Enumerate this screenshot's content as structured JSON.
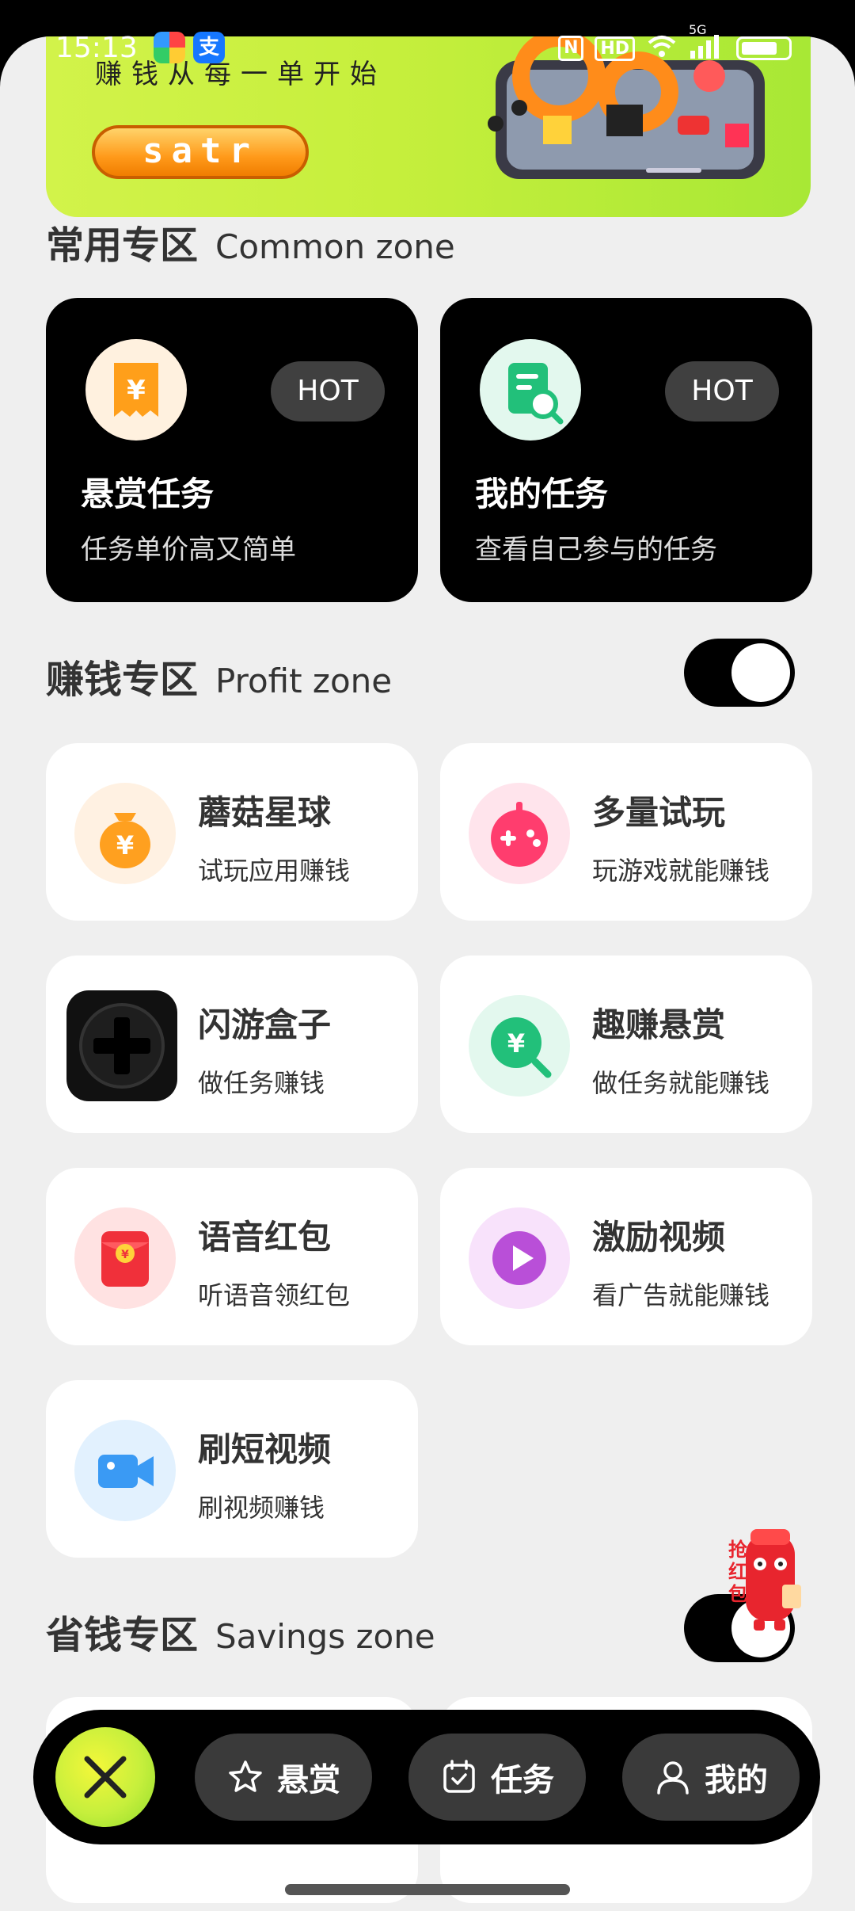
{
  "status": {
    "time": "15:13",
    "network": "5G"
  },
  "banner": {
    "slogan": "赚钱从每一单开始",
    "start_label": "satr"
  },
  "common": {
    "title": "常用专区",
    "subtitle": "Common zone",
    "cards": [
      {
        "title": "悬赏任务",
        "desc": "任务单价高又简单",
        "badge": "HOT",
        "icon": "reward-receipt-icon",
        "color": "#ff9f1a"
      },
      {
        "title": "我的任务",
        "desc": "查看自己参与的任务",
        "badge": "HOT",
        "icon": "task-search-icon",
        "color": "#22c07a"
      }
    ]
  },
  "profit": {
    "title": "赚钱专区",
    "subtitle": "Profit zone",
    "toggle_on": true,
    "items": [
      {
        "title": "蘑菇星球",
        "desc": "试玩应用赚钱",
        "icon": "money-bag-icon"
      },
      {
        "title": "多量试玩",
        "desc": "玩游戏就能赚钱",
        "icon": "gamepad-icon"
      },
      {
        "title": "闪游盒子",
        "desc": "做任务赚钱",
        "icon": "joystick-box-icon"
      },
      {
        "title": "趣赚悬赏",
        "desc": "做任务就能赚钱",
        "icon": "yuan-search-icon"
      },
      {
        "title": "语音红包",
        "desc": "听语音领红包",
        "icon": "red-packet-icon"
      },
      {
        "title": "激励视频",
        "desc": "看广告就能赚钱",
        "icon": "play-video-icon"
      },
      {
        "title": "刷短视频",
        "desc": "刷视频赚钱",
        "icon": "video-camera-icon"
      }
    ]
  },
  "savings": {
    "title": "省钱专区",
    "subtitle": "Savings zone",
    "toggle_on": true
  },
  "nav": {
    "items": [
      {
        "label": "悬赏",
        "icon": "star-icon"
      },
      {
        "label": "任务",
        "icon": "calendar-check-icon"
      },
      {
        "label": "我的",
        "icon": "user-icon"
      }
    ]
  },
  "floating": {
    "text": "抢红包"
  }
}
